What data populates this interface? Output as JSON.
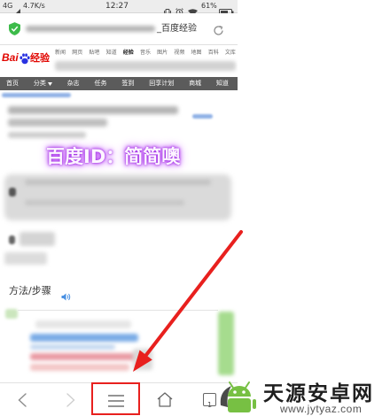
{
  "status_bar": {
    "network": "4G",
    "speed": "4.7K/s",
    "time": "12:27",
    "battery": "61%",
    "icons": [
      "signal-icon",
      "vibrate-icon",
      "alarm-icon",
      "wifi-icon",
      "battery-icon"
    ]
  },
  "address_bar": {
    "title_suffix": "_百度经验",
    "icons": [
      "shield-icon",
      "refresh-icon"
    ]
  },
  "baidu_header": {
    "logo_prefix": "Bai",
    "logo_suffix": "经验",
    "logo_icon": "paw-icon",
    "nav_links": [
      "新闻",
      "网页",
      "贴吧",
      "知道",
      "经验",
      "音乐",
      "图片",
      "视频",
      "地图",
      "百科",
      "文库"
    ]
  },
  "site_nav": {
    "items": [
      "首页",
      "分类",
      "杂志",
      "任务",
      "签到",
      "回享计划",
      "商城",
      "知道"
    ],
    "dropdown_icon": "chevron-down-icon"
  },
  "article": {
    "overlay_text": "百度ID：简简噢",
    "section_heading": "方法/步骤",
    "heading_icon": "speaker-icon"
  },
  "bottom_toolbar": {
    "tab_count": "1",
    "icons": [
      "back-icon",
      "forward-icon",
      "menu-icon",
      "home-icon",
      "tabs-icon"
    ]
  },
  "site_watermark": {
    "name": "天源安卓网",
    "url": "www.jytyaz.com",
    "logo_icon": "android-logo-icon"
  },
  "colors": {
    "baidu_red": "#e10601",
    "baidu_blue": "#2932e1",
    "nav_bg": "#5b5b5b",
    "annotation_red": "#e8201e",
    "overlay_glow": "#b23cf0",
    "secure_green": "#3dbb4a"
  }
}
